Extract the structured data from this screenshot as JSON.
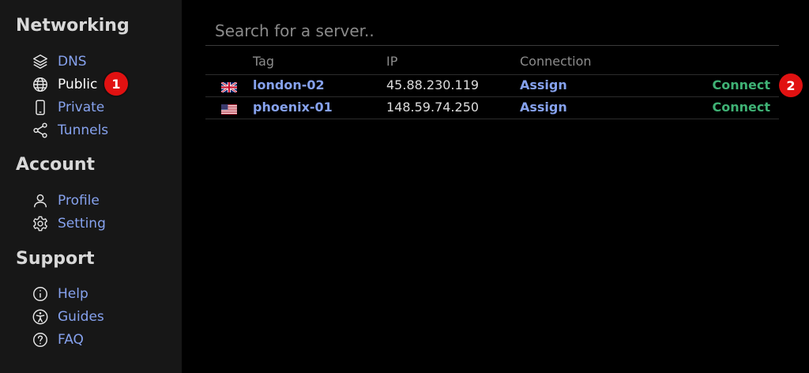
{
  "sidebar": {
    "networking": {
      "title": "Networking",
      "items": [
        {
          "label": "DNS",
          "icon": "layers-icon"
        },
        {
          "label": "Public",
          "icon": "globe-icon"
        },
        {
          "label": "Private",
          "icon": "phone-icon"
        },
        {
          "label": "Tunnels",
          "icon": "share-nodes-icon"
        }
      ]
    },
    "account": {
      "title": "Account",
      "items": [
        {
          "label": "Profile",
          "icon": "user-icon"
        },
        {
          "label": "Setting",
          "icon": "gear-icon"
        }
      ]
    },
    "support": {
      "title": "Support",
      "items": [
        {
          "label": "Help",
          "icon": "info-circle-icon"
        },
        {
          "label": "Guides",
          "icon": "accessibility-icon"
        },
        {
          "label": "FAQ",
          "icon": "question-circle-icon"
        }
      ]
    }
  },
  "badges": {
    "one": "1",
    "two": "2"
  },
  "search": {
    "placeholder": "Search for a server..",
    "value": ""
  },
  "table": {
    "headers": {
      "tag": "Tag",
      "ip": "IP",
      "connection": "Connection"
    },
    "rows": [
      {
        "flag": "uk-flag-icon",
        "tag": "london-02",
        "ip": "45.88.230.119",
        "assign": "Assign",
        "connect": "Connect"
      },
      {
        "flag": "us-flag-icon",
        "tag": "phoenix-01",
        "ip": "148.59.74.250",
        "assign": "Assign",
        "connect": "Connect"
      }
    ]
  },
  "colors": {
    "sidebar_bg": "#171717",
    "link": "#86a2ee",
    "connect": "#3fb275",
    "badge": "#e11111",
    "active": "#ffffff"
  }
}
